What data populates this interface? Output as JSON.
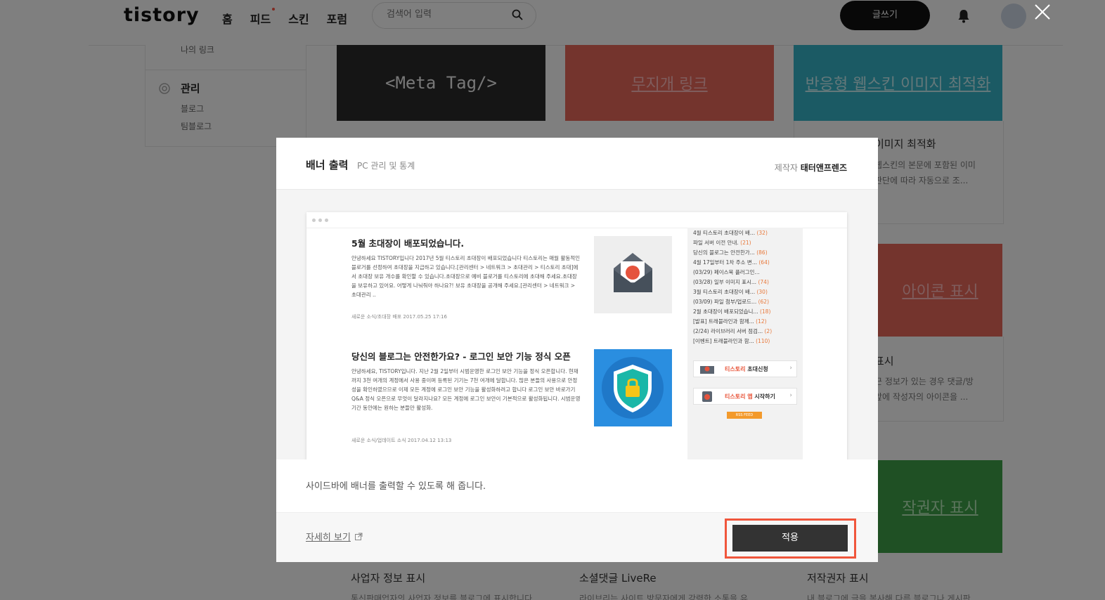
{
  "header": {
    "logo": "tistory",
    "nav": [
      "홈",
      "피드",
      "스킨",
      "포럼"
    ],
    "search_placeholder": "검색어 입력",
    "write_label": "글쓰기"
  },
  "sidebar": {
    "link": "나의 링크",
    "manage_title": "관리",
    "items": [
      "블로그",
      "팀블로그"
    ]
  },
  "cards": {
    "c1_image_text": "<Meta Tag/>",
    "c2_image_text": "무지개 링크",
    "c3_image_text": "반응형 웹스킨 이미지 최적화",
    "c3_title": "이미지 최적화",
    "c3_desc1": "웹스킨의 본문에 포함된 이미",
    "c3_desc2": "판단에 따라 자동으로 조...",
    "c4_image_text": "아이콘 표시",
    "c4_title": "표시",
    "c4_desc1": "근 정보가 있는 경우 댓글/방",
    "c4_desc2": "앞에 작성자의 아이콘을 ...",
    "c5_image_text": "작권자 표시",
    "bottom": [
      {
        "title": "사업자 정보 표시",
        "desc": "통신판매업자의 사업자 정보를 블로그에 표시합니다"
      },
      {
        "title": "소셜댓글 LiveRe",
        "desc": "라이브리는 사이트 방문자에게 강력한 소통을 유"
      },
      {
        "title": "저작권자 표시",
        "desc": "내 블로그에 글을 복사해 다른 블로그나 게시판"
      }
    ]
  },
  "modal": {
    "title": "배너 출력",
    "category": "PC 관리 및 통계",
    "maker_label": "제작자",
    "maker_name": "태터앤프렌즈",
    "description": "사이드바에 배너를 출력할 수 있도록 해 줍니다.",
    "more_label": "자세히 보기",
    "apply_label": "적용",
    "preview": {
      "posts": [
        {
          "title": "5월 초대장이 배포되었습니다.",
          "body": "안녕하세요 TISTORY입니다 2017년 5월 티스토리 초대장이 배포되었습니다 티스토리는 매월 활동적인 블로거를 선정하여 초대장을 지급하고 있습니다.[관리센터 > 네트워크 > 초대관리 > 티스토리 초대]에서 초대장 보유 개수를 확인할 수 있습니다.초대장으로 예비 블로거를 티스토리에 초대해 주세요.초대장을 보유하고 있어요. 어떻게 나눠줘야 하나요?! 보유 초대장을 공개해 주세요.[관리센터 > 네트워크 > 초대관리 ..",
          "meta": "새로운 소식/초대장 배포    2017.05.25 17:16"
        },
        {
          "title": "당신의 블로그는 안전한가요? - 로그인 보안 기능 정식 오픈",
          "body": "안녕하세요, TISTORY입니다. 지난 2월 2일부터 시범운영한 로그인 보안 기능을 정식 오픈합니다. 현재까지 3천 여개의 계정에서 사용 중이며 등록된 기기는 7천 여개에 달합니다. 많은 분들의 사용으로 안정성을 확인하였으므로 이제 모든 계정에 로그인 보안 기능을 활성화하려고 합니다 로그인 보안 바로가기 Q&A 정식 오픈으로 무엇이 달라지나요? 모든 계정에 로그인 보안이 기본적으로 활성화됩니다. 시범운영 기간 동안에는 원하는 분들만 활성화.",
          "meta": "새로운 소식/업데이트 소식    2017.04.12 13:13"
        }
      ],
      "side_list": [
        {
          "text": "4월 티스토리 초대장이 배...",
          "count": "(32)"
        },
        {
          "text": "파일 서버 이전 안내.",
          "count": "(21)"
        },
        {
          "text": "당신의 블로그는 안전한가...",
          "count": "(86)"
        },
        {
          "text": "4월 17일부터 1차 주소 변...",
          "count": "(64)"
        },
        {
          "text": "(03/29) 페이스북 플러그인...",
          "count": ""
        },
        {
          "text": "(03/28) 일부 이미지 표시...",
          "count": "(74)"
        },
        {
          "text": "3월 티스토리 초대장이 배...",
          "count": "(30)"
        },
        {
          "text": "(03/09) 파일 첨부/업로드...",
          "count": "(62)"
        },
        {
          "text": "2월 초대장이 배포되었습니...",
          "count": "(18)"
        },
        {
          "text": "[발표] 트래블라인과 함께...",
          "count": "(12)"
        },
        {
          "text": "(2/24) 라이브러리 서버 점검...",
          "count": "(2)"
        },
        {
          "text": "[이벤트] 트래블라인과 함...",
          "count": "(110)"
        }
      ],
      "banner1_brand": "티스토리",
      "banner1_text": "초대신청",
      "banner2_brand": "티스토리 앱",
      "banner2_text": "시작하기",
      "rss": "RSS FEED"
    }
  },
  "colors": {
    "accent_red": "#f0563c",
    "dark_button": "#333333"
  }
}
